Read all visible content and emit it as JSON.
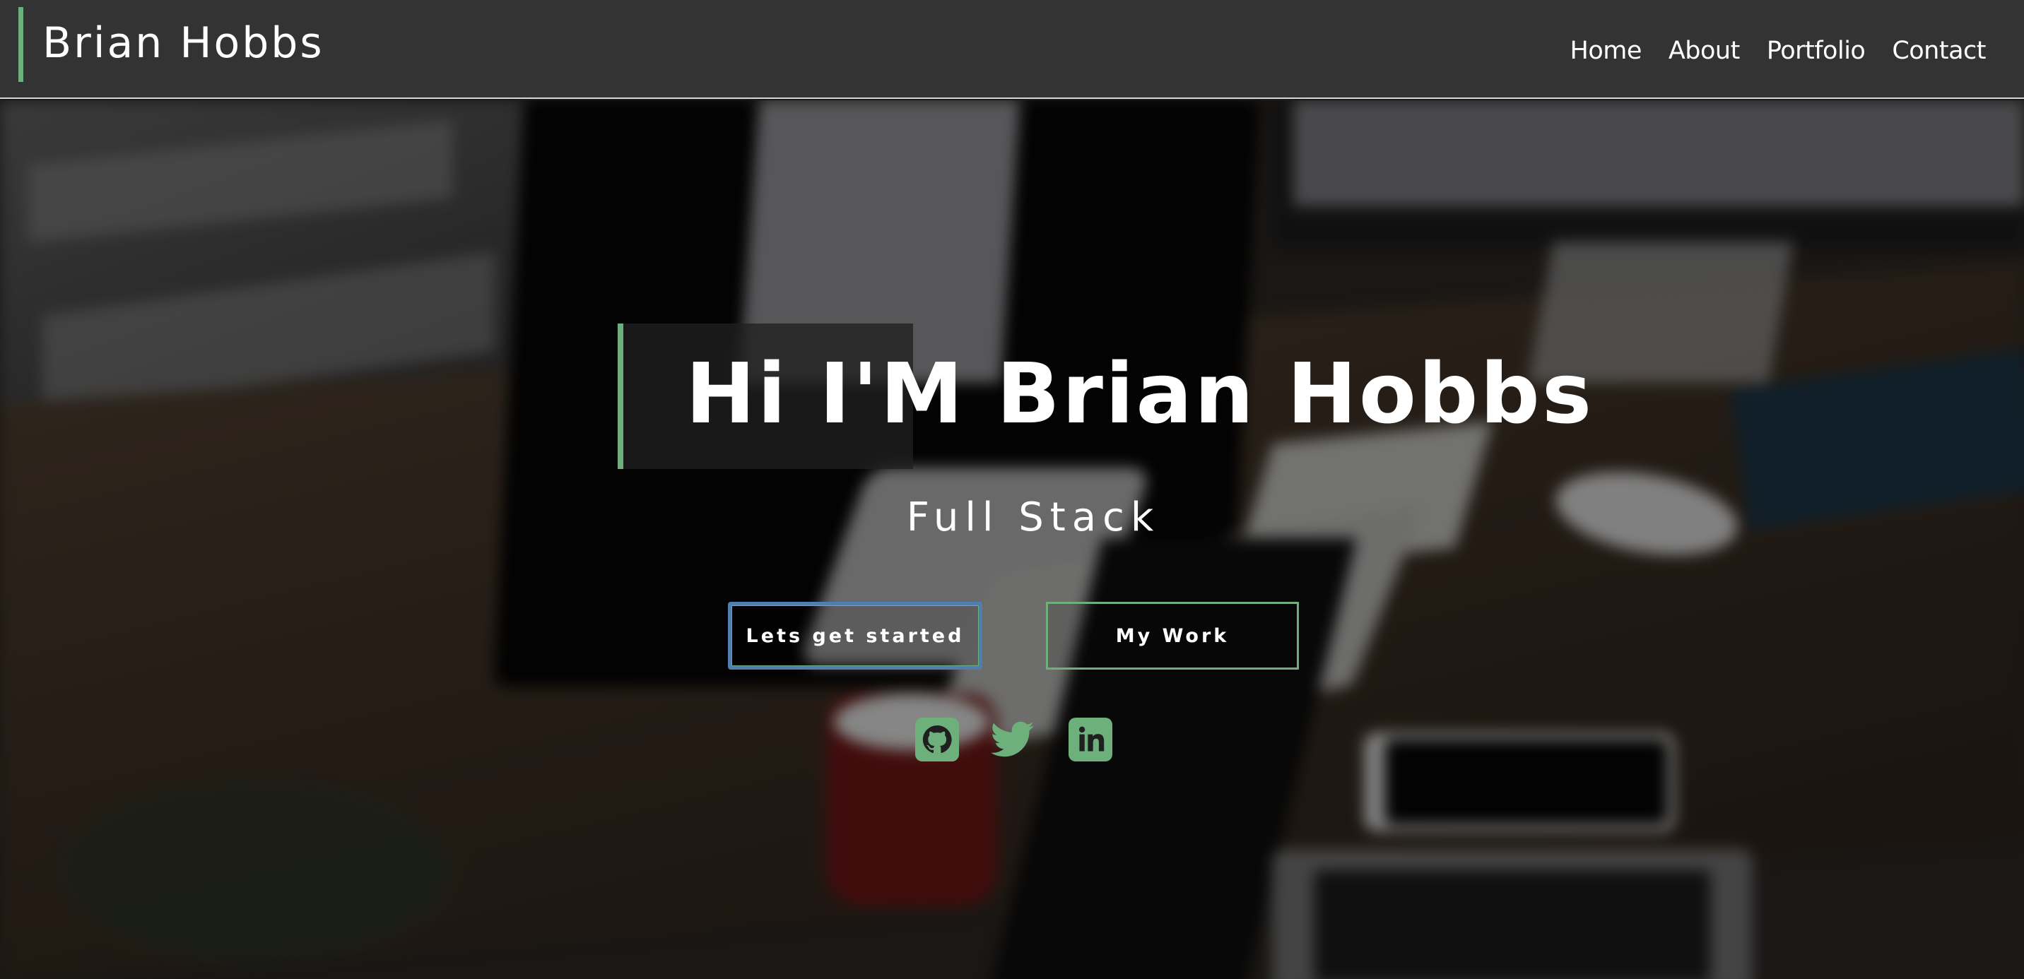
{
  "header": {
    "brand": "Brian Hobbs",
    "nav": [
      {
        "label": "Home"
      },
      {
        "label": "About"
      },
      {
        "label": "Portfolio"
      },
      {
        "label": "Contact"
      }
    ]
  },
  "hero": {
    "headline": "Hi I'M Brian Hobbs",
    "subtitle": "Full Stack",
    "primary_button": "Lets get started",
    "secondary_button": "My Work",
    "social": [
      {
        "icon": "github-icon"
      },
      {
        "icon": "twitter-icon"
      },
      {
        "icon": "linkedin-icon"
      }
    ]
  },
  "colors": {
    "accent": "#6db07b",
    "navbar": "#333333",
    "focus_ring": "#4f7fb0"
  }
}
